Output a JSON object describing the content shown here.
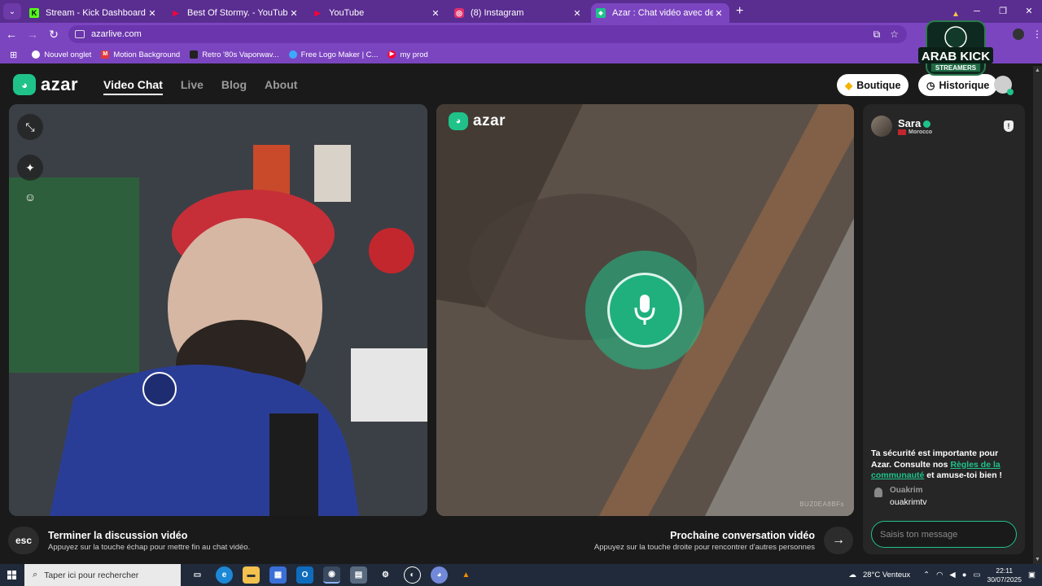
{
  "browser": {
    "tabs": [
      {
        "title": "Stream - Kick Dashboard",
        "favicon": "K",
        "color": "#53fc18",
        "active": false
      },
      {
        "title": "Best Of Stormy. - YouTube",
        "favicon": "▶",
        "color": "#ff0033",
        "active": false
      },
      {
        "title": "YouTube",
        "favicon": "▶",
        "color": "#ff0033",
        "active": false
      },
      {
        "title": "(8) Instagram",
        "favicon": "◎",
        "color": "#e1306c",
        "active": false
      },
      {
        "title": "Azar : Chat vidéo avec de n",
        "favicon": "◆",
        "color": "#1fc38a",
        "active": true
      }
    ],
    "url": "azarlive.com",
    "bookmarks": [
      {
        "label": "Nouvel onglet",
        "color": "#ffffff"
      },
      {
        "label": "Motion Background",
        "color": "#e53935"
      },
      {
        "label": "Retro '80s Vaporwav...",
        "color": "#222222"
      },
      {
        "label": "Free Logo Maker | C...",
        "color": "#3da9fc"
      },
      {
        "label": "my prod",
        "color": "#ff0033"
      }
    ]
  },
  "azar": {
    "logo": "azar",
    "nav": [
      "Video Chat",
      "Live",
      "Blog",
      "About"
    ],
    "boutique": "Boutique",
    "historique": "Historique",
    "remote_id": "BUZ0EA8BFs",
    "end_title": "Terminer la discussion vidéo",
    "end_sub": "Appuyez sur la touche échap pour mettre fin au chat vidéo.",
    "esc_label": "esc",
    "next_title": "Prochaine conversation vidéo",
    "next_sub": "Appuyez sur la touche droite pour rencontrer d'autres personnes",
    "chat": {
      "partner_name": "Sara",
      "partner_country": "Morocco",
      "safety_pre": "Ta sécurité est importante pour Azar. Consulte nos ",
      "safety_link": "Règles de la communauté",
      "safety_post": " et amuse-toi bien !",
      "msg_user": "Ouakrim",
      "msg_text": "ouakrimtv",
      "input_placeholder": "Saisis ton message"
    },
    "accent": "#1fc38a"
  },
  "watermark": {
    "line1": "ARAB KICK",
    "line2": "STREAMERS"
  },
  "taskbar": {
    "search_placeholder": "Taper ici pour rechercher",
    "weather": "28°C Venteux",
    "time": "22:11",
    "date": "30/07/2025"
  }
}
